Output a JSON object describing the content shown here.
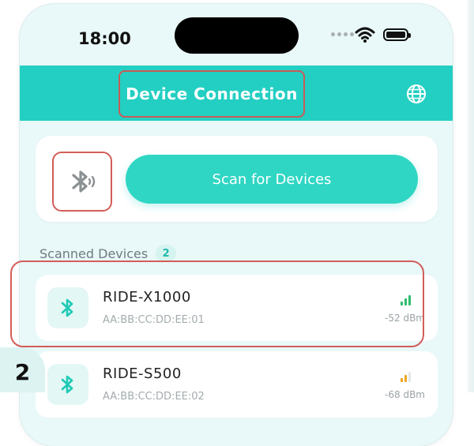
{
  "status_bar": {
    "time": "18:00"
  },
  "header": {
    "title": "Device Connection",
    "globe_icon": "globe-icon"
  },
  "scan": {
    "button_label": "Scan for Devices",
    "bluetooth_icon": "bluetooth-audio-icon"
  },
  "list": {
    "title": "Scanned Devices",
    "count": "2",
    "devices": [
      {
        "name": "RIDE-X1000",
        "mac": "AA:BB:CC:DD:EE:01",
        "rssi": "-52 dBm",
        "signal_level": 3,
        "signal_color": "#2dbd6e"
      },
      {
        "name": "RIDE-S500",
        "mac": "AA:BB:CC:DD:EE:02",
        "rssi": "-68 dBm",
        "signal_level": 2,
        "signal_color": "#f0a51d"
      }
    ]
  },
  "step_badge": "2",
  "colors": {
    "accent": "#23cfc2",
    "highlight": "#d25d58",
    "background": "#e9f8f8"
  }
}
